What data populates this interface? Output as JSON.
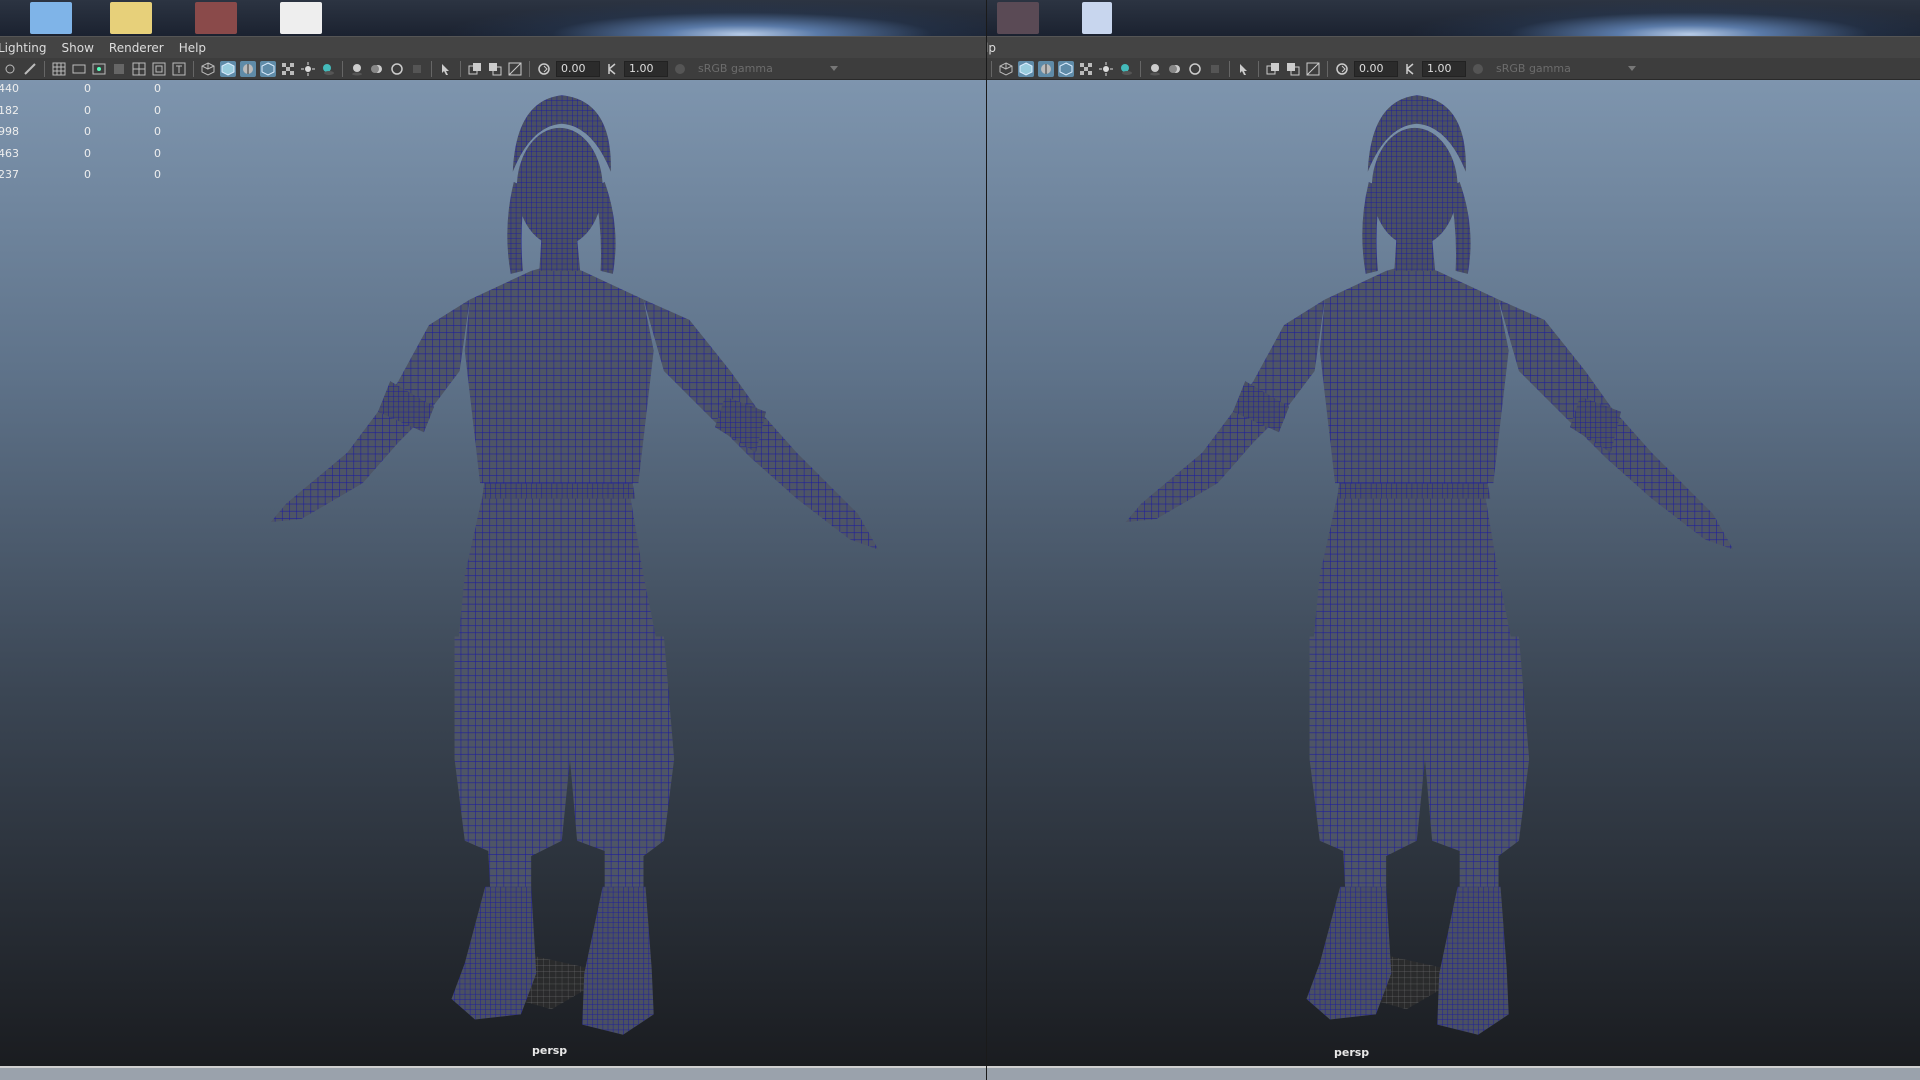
{
  "left_viewport": {
    "menu": [
      "Lighting",
      "Show",
      "Renderer",
      "Help"
    ],
    "toolbar": {
      "field_1": "0.00",
      "field_2": "1.00",
      "color_space": "sRGB gamma"
    },
    "hud_rows": [
      [
        "440",
        "0",
        "0"
      ],
      [
        "182",
        "0",
        "0"
      ],
      [
        "998",
        "0",
        "0"
      ],
      [
        "463",
        "0",
        "0"
      ],
      [
        "237",
        "0",
        "0"
      ]
    ],
    "camera_label": "persp"
  },
  "right_viewport": {
    "menu": [
      "lp"
    ],
    "toolbar": {
      "field_1": "0.00",
      "field_2": "1.00",
      "color_space": "sRGB gamma"
    },
    "camera_label": "persp"
  },
  "icons": {
    "viewport_shading": "cube-icon",
    "lights": "light-icon",
    "isolate": "isolate-icon",
    "exposure": "exposure-icon",
    "gamma": "gamma-icon",
    "color_management": "color-management-icon",
    "dropdown": "chevron-down-icon"
  },
  "colors": {
    "wireframe": "#1e1e9c",
    "mesh_fill": "#4e5566",
    "toolbar_active": "#5f8ba8",
    "viewport_top": "#7e95ae",
    "viewport_bottom": "#1a1c20"
  }
}
